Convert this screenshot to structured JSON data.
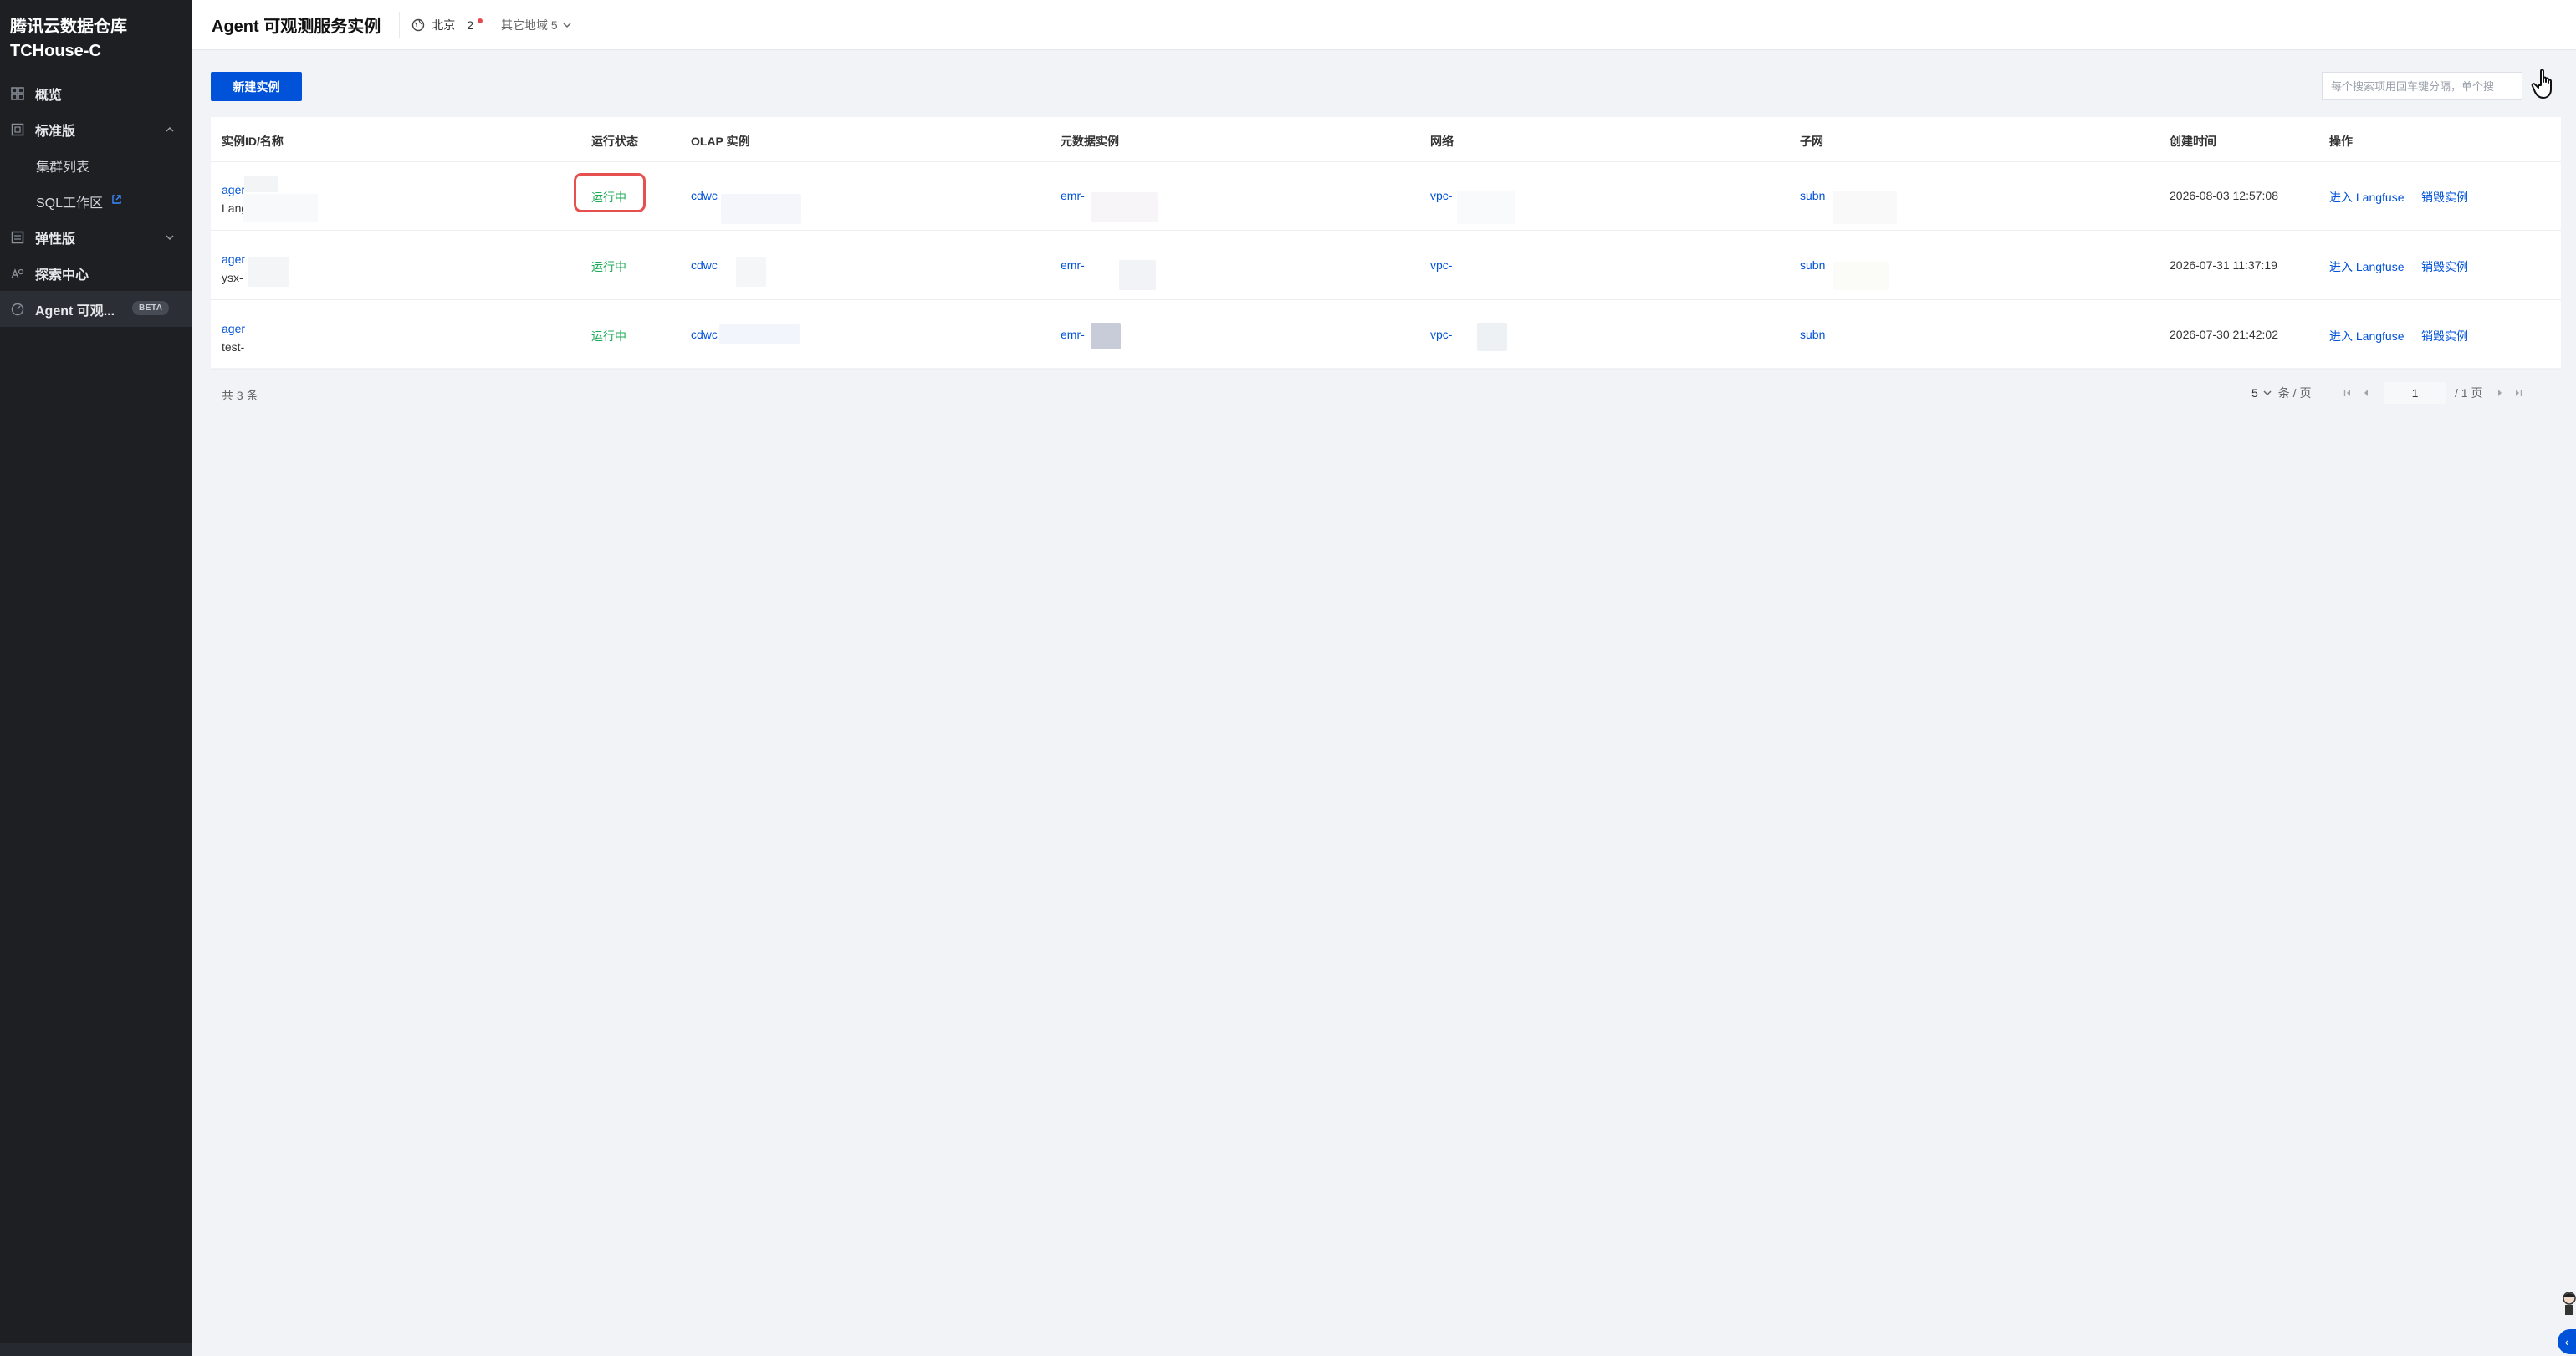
{
  "sidebar": {
    "brand_line1": "腾讯云数据仓库",
    "brand_line2": "TCHouse-C",
    "items": [
      {
        "label": "概览",
        "icon": "grid-icon"
      },
      {
        "label": "标准版",
        "icon": "copy-icon"
      },
      {
        "label": "集群列表"
      },
      {
        "label": "SQL工作区",
        "icon": "external-link-icon"
      },
      {
        "label": "弹性版",
        "icon": "stack-icon"
      },
      {
        "label": "探索中心",
        "icon": "explore-icon"
      },
      {
        "label": "Agent 可观...",
        "icon": "gauge-icon",
        "badge": "BETA"
      }
    ]
  },
  "header": {
    "title": "Agent 可观测服务实例",
    "region_label": "北京",
    "region_count": "2",
    "other_regions": "其它地域 5"
  },
  "toolbar": {
    "create_label": "新建实例",
    "search_placeholder": "每个搜索项用回车键分隔，单个搜"
  },
  "table": {
    "headers": [
      "实例ID/名称",
      "运行状态",
      "OLAP 实例",
      "元数据实例",
      "网络",
      "子网",
      "创建时间",
      "操作"
    ],
    "rows": [
      {
        "id": "ager",
        "name": "Lang",
        "status": "运行中",
        "olap": "cdwc",
        "meta": "emr-",
        "vpc": "vpc-",
        "subnet": "subn",
        "created": "2026-08-03 12:57:08",
        "action1": "进入 Langfuse",
        "action2": "销毁实例"
      },
      {
        "id": "ager",
        "name": "ysx-",
        "status": "运行中",
        "olap": "cdwc",
        "meta": "emr-",
        "vpc": "vpc-",
        "subnet": "subn",
        "created": "2026-07-31 11:37:19",
        "action1": "进入 Langfuse",
        "action2": "销毁实例"
      },
      {
        "id": "ager",
        "name": "test-",
        "status": "运行中",
        "olap": "cdwc",
        "meta": "emr-",
        "vpc": "vpc-",
        "subnet": "subn",
        "created": "2026-07-30 21:42:02",
        "action1": "进入 Langfuse",
        "action2": "销毁实例"
      }
    ]
  },
  "footer": {
    "total": "共 3 条",
    "page_size": "5",
    "page_size_unit": "条 / 页",
    "current_page": "1",
    "total_pages": "/ 1 页"
  },
  "colors": {
    "accent": "#0052d9",
    "status_running": "#1dab57",
    "highlight": "#e6504f",
    "sidebar_bg": "#1d1f23"
  }
}
